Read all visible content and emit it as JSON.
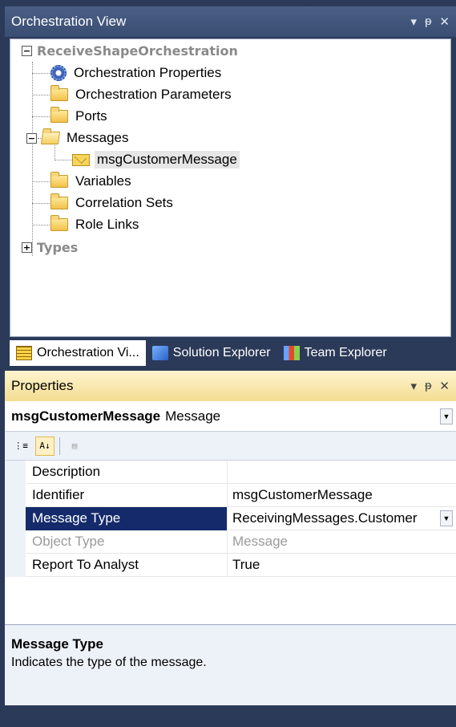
{
  "orchestration_view": {
    "title": "Orchestration View",
    "pin_icon": "pin-icon",
    "close_icon": "close-icon",
    "root_label": "ReceiveShapeOrchestration",
    "nodes": [
      {
        "label": "Orchestration Properties",
        "icon": "gear-icon"
      },
      {
        "label": "Orchestration Parameters",
        "icon": "folder-icon"
      },
      {
        "label": "Ports",
        "icon": "folder-icon"
      },
      {
        "label": "Messages",
        "icon": "open-folder-icon"
      },
      {
        "label": "msgCustomerMessage",
        "icon": "envelope-icon"
      },
      {
        "label": "Variables",
        "icon": "folder-icon"
      },
      {
        "label": "Correlation Sets",
        "icon": "folder-icon"
      },
      {
        "label": "Role Links",
        "icon": "folder-icon"
      }
    ],
    "types_label": "Types"
  },
  "tabs": [
    {
      "label": "Orchestration Vi...",
      "active": true
    },
    {
      "label": "Solution Explorer",
      "active": false
    },
    {
      "label": "Team Explorer",
      "active": false
    }
  ],
  "properties": {
    "title": "Properties",
    "object_name": "msgCustomerMessage",
    "object_type": "Message",
    "rows": [
      {
        "name": "Description",
        "value": ""
      },
      {
        "name": "Identifier",
        "value": "msgCustomerMessage"
      },
      {
        "name": "Message Type",
        "value": "ReceivingMessages.Customer"
      },
      {
        "name": "Object Type",
        "value": "Message"
      },
      {
        "name": "Report To Analyst",
        "value": "True"
      }
    ],
    "description_title": "Message Type",
    "description_text": "Indicates the type of the message."
  },
  "glyphs": {
    "minus": "−",
    "plus": "+",
    "down": "▾",
    "pin": "ᵽ",
    "close": "✕",
    "dropdown": "▼",
    "categorized": "⋮≡",
    "alphabetical": "A↓",
    "pages": "▤"
  }
}
